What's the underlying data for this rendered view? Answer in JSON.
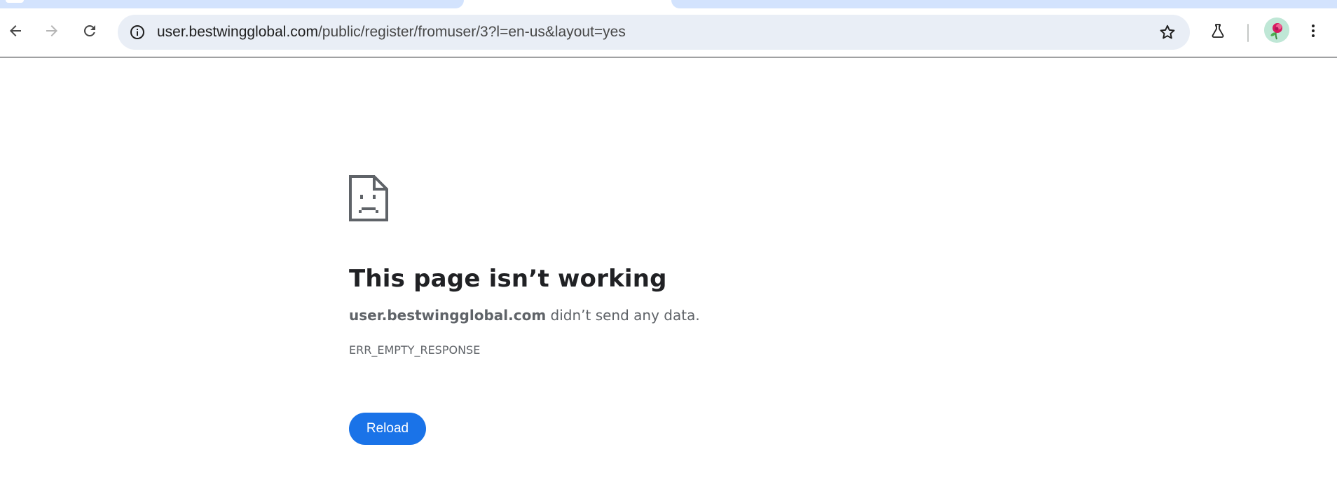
{
  "browser": {
    "url_domain": "user.bestwingglobal.com",
    "url_path": "/public/register/fromuser/3?l=en-us&layout=yes",
    "colors": {
      "tab_strip": "#d3e3fd",
      "omnibox": "#e9eef6"
    }
  },
  "error_page": {
    "title": "This page isn’t working",
    "host": "user.bestwingglobal.com",
    "message": "didn’t send any data.",
    "error_code": "ERR_EMPTY_RESPONSE",
    "reload_label": "Reload",
    "accent_color": "#1a73e8",
    "icon": "sad-page-icon"
  }
}
